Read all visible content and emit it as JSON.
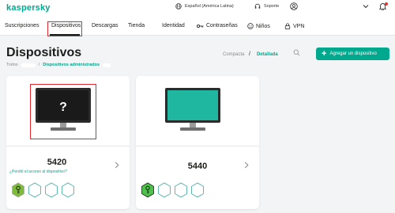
{
  "brand": {
    "name": "kaspersky",
    "color": "#00a88e"
  },
  "topbar": {
    "language": "Español (América Latina)",
    "support": "Soporte"
  },
  "nav": {
    "items": [
      {
        "label": "Suscripciones",
        "icon": ""
      },
      {
        "label": "Dispositivos",
        "icon": "",
        "active": true
      },
      {
        "label": "Descargas",
        "icon": ""
      },
      {
        "label": "Tienda",
        "icon": ""
      },
      {
        "label": "Identidad",
        "icon": ""
      },
      {
        "label": "Contraseñas",
        "icon": "key-icon"
      },
      {
        "label": "Niños",
        "icon": "kids-icon"
      },
      {
        "label": "VPN",
        "icon": "vpn-lock-icon"
      }
    ]
  },
  "page": {
    "title": "Dispositivos",
    "breadcrumb": {
      "all": "Todos",
      "separator": "/",
      "current": "Dispositivos administrados"
    },
    "view": {
      "compact": "Compacta",
      "separator": "/",
      "detailed": "Detallada"
    },
    "add_button": "Agregar un dispositivo"
  },
  "devices": [
    {
      "name": "5420",
      "screen": "unknown",
      "screen_mark": "?",
      "link": "¿Perdió el acceso al dispositivo?",
      "badges_active": 1
    },
    {
      "name": "5440",
      "screen": "protected",
      "link": "",
      "badges_active": 1
    }
  ],
  "colors": {
    "accent": "#00a88e",
    "highlight": "#e0282e",
    "active_badge": "#7dbb3c"
  }
}
